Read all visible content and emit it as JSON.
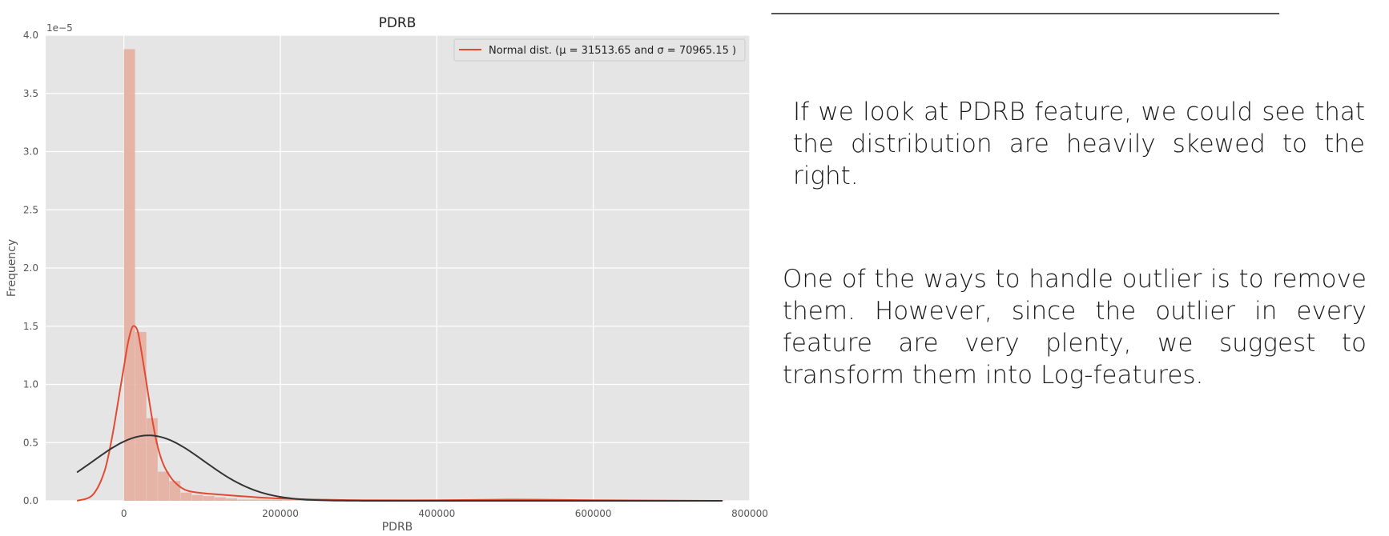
{
  "chart_data": {
    "type": "histogram",
    "title": "PDRB",
    "xlabel": "PDRB",
    "ylabel": "Frequency",
    "y_scale_note": "1e−5",
    "xlim": [
      -100000,
      800000
    ],
    "ylim": [
      0,
      4.0
    ],
    "xticks": [
      0,
      200000,
      400000,
      600000,
      800000
    ],
    "yticks": [
      0.0,
      0.5,
      1.0,
      1.5,
      2.0,
      2.5,
      3.0,
      3.5,
      4.0
    ],
    "bars": {
      "bin_width": 14500,
      "x_start": 0,
      "heights": [
        3.88,
        1.45,
        0.71,
        0.25,
        0.17,
        0.07,
        0.05,
        0.04,
        0.03,
        0.02,
        0.01,
        0.01,
        0.01,
        0.01,
        0.005,
        0.005,
        0.005,
        0,
        0,
        0,
        0,
        0,
        0,
        0,
        0,
        0,
        0,
        0,
        0,
        0,
        0,
        0,
        0,
        0.003,
        0.003,
        0,
        0,
        0,
        0,
        0,
        0,
        0,
        0,
        0,
        0,
        0,
        0,
        0,
        0,
        0,
        0,
        0,
        0.003
      ]
    },
    "kde_curve": {
      "x": [
        -60000,
        -40000,
        -25000,
        -15000,
        -5000,
        0,
        5000,
        10000,
        14000,
        18000,
        22000,
        28000,
        35000,
        42000,
        50000,
        60000,
        70000,
        80000,
        95000,
        110000,
        130000,
        150000,
        170000,
        200000,
        250000,
        300000,
        400000,
        500000,
        600000,
        765000
      ],
      "y": [
        0.0,
        0.05,
        0.25,
        0.55,
        0.95,
        1.15,
        1.35,
        1.48,
        1.5,
        1.45,
        1.3,
        1.05,
        0.75,
        0.5,
        0.32,
        0.2,
        0.13,
        0.09,
        0.07,
        0.06,
        0.05,
        0.04,
        0.03,
        0.02,
        0.01,
        0.005,
        0.005,
        0.01,
        0.005,
        0.0
      ]
    },
    "normal_fit": {
      "mu": 31513.65,
      "sigma": 70965.15,
      "x_range": [
        -60000,
        765000
      ]
    },
    "legend": {
      "label": "Normal dist. (μ = 31513.65 and σ = 70965.15 )",
      "placement": "upper right"
    },
    "grid": true,
    "colors": {
      "bars": "#E5AE9F",
      "kde": "#E24A33",
      "normal": "#333333",
      "plot_bg": "#E5E5E5",
      "grid": "#FFFFFF",
      "tick_text": "#555555"
    }
  },
  "text": {
    "paragraph1": "If we look at PDRB feature, we could see that the distribution are heavily skewed to the right.",
    "paragraph2": "One of the ways to handle outlier is to remove them. However, since the outlier in every feature are very plenty, we suggest to transform them into Log-features."
  }
}
